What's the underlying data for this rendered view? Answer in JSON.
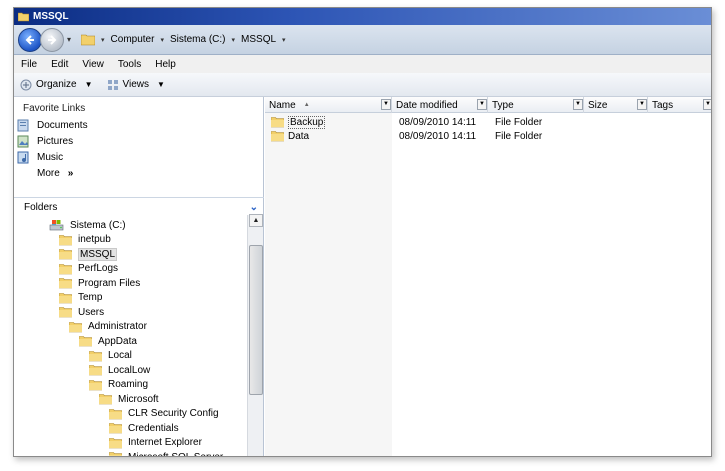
{
  "window": {
    "title": "MSSQL"
  },
  "address": {
    "crumbs": [
      "Computer",
      "Sistema (C:)",
      "MSSQL"
    ]
  },
  "menu": [
    "File",
    "Edit",
    "View",
    "Tools",
    "Help"
  ],
  "toolbar": {
    "organize": "Organize",
    "views": "Views"
  },
  "favorites": {
    "title": "Favorite Links",
    "items": [
      "Documents",
      "Pictures",
      "Music"
    ],
    "more": "More",
    "more_glyph": "»"
  },
  "folders": {
    "title": "Folders",
    "tree": [
      {
        "label": "Sistema (C:)",
        "level": 0,
        "type": "drive"
      },
      {
        "label": "inetpub",
        "level": 1
      },
      {
        "label": "MSSQL",
        "level": 1,
        "selected": true
      },
      {
        "label": "PerfLogs",
        "level": 1
      },
      {
        "label": "Program Files",
        "level": 1
      },
      {
        "label": "Temp",
        "level": 1
      },
      {
        "label": "Users",
        "level": 1
      },
      {
        "label": "Administrator",
        "level": 2
      },
      {
        "label": "AppData",
        "level": 3
      },
      {
        "label": "Local",
        "level": 4
      },
      {
        "label": "LocalLow",
        "level": 4
      },
      {
        "label": "Roaming",
        "level": 4
      },
      {
        "label": "Microsoft",
        "level": 5
      },
      {
        "label": "CLR Security Config",
        "level": 6
      },
      {
        "label": "Credentials",
        "level": 6
      },
      {
        "label": "Internet Explorer",
        "level": 6
      },
      {
        "label": "Microsoft SQL Server",
        "level": 6
      }
    ]
  },
  "columns": {
    "name": "Name",
    "date": "Date modified",
    "type": "Type",
    "size": "Size",
    "tags": "Tags"
  },
  "files": [
    {
      "name": "Backup",
      "date": "08/09/2010 14:11",
      "type": "File Folder",
      "size": ""
    },
    {
      "name": "Data",
      "date": "08/09/2010 14:11",
      "type": "File Folder",
      "size": ""
    }
  ],
  "colors": {
    "title_bar": "#0b2c82",
    "selection": "#e3e3e3",
    "folder": "#e9c15a"
  }
}
